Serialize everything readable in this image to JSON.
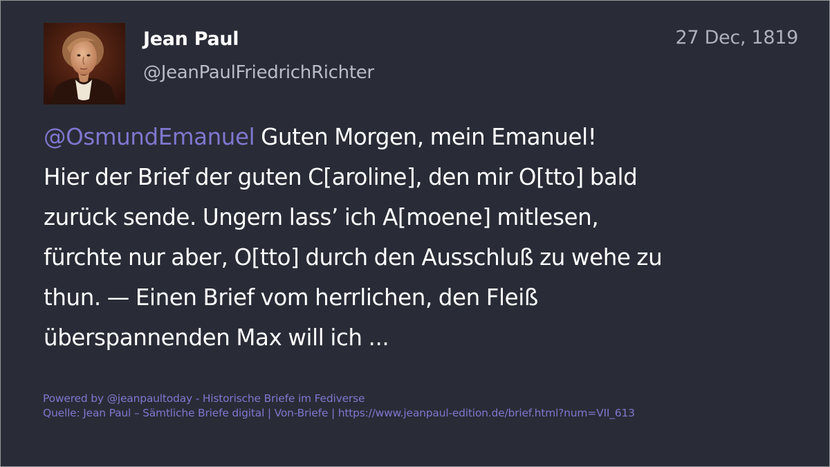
{
  "author": {
    "display_name": "Jean Paul",
    "handle": "@JeanPaulFriedrichRichter"
  },
  "post": {
    "date": "27 Dec, 1819",
    "mention": "@OsmundEmanuel",
    "lines": [
      " Guten Morgen, mein Emanuel!",
      "Hier der Brief der guten C[aroline], den mir O[tto] bald",
      "zurück sende. Ungern lass’ ich A[moene] mitlesen,",
      "fürchte nur aber, O[tto] durch den Ausschluß zu wehe zu",
      "thun. — Einen Brief vom herrlichen, den Fleiß",
      "überspannenden Max will ich ..."
    ]
  },
  "footer": {
    "powered_by": "Powered by @jeanpaultoday - Historische Briefe im Fediverse",
    "source": "Quelle: Jean Paul – Sämtliche Briefe digital | Von-Briefe | https://www.jeanpaul-edition.de/brief.html?num=VII_613"
  },
  "icons": {
    "avatar": "portrait-avatar"
  },
  "colors": {
    "background": "#292c36",
    "text": "#ffffff",
    "muted": "#b9bcc6",
    "accent": "#7e77cf"
  }
}
